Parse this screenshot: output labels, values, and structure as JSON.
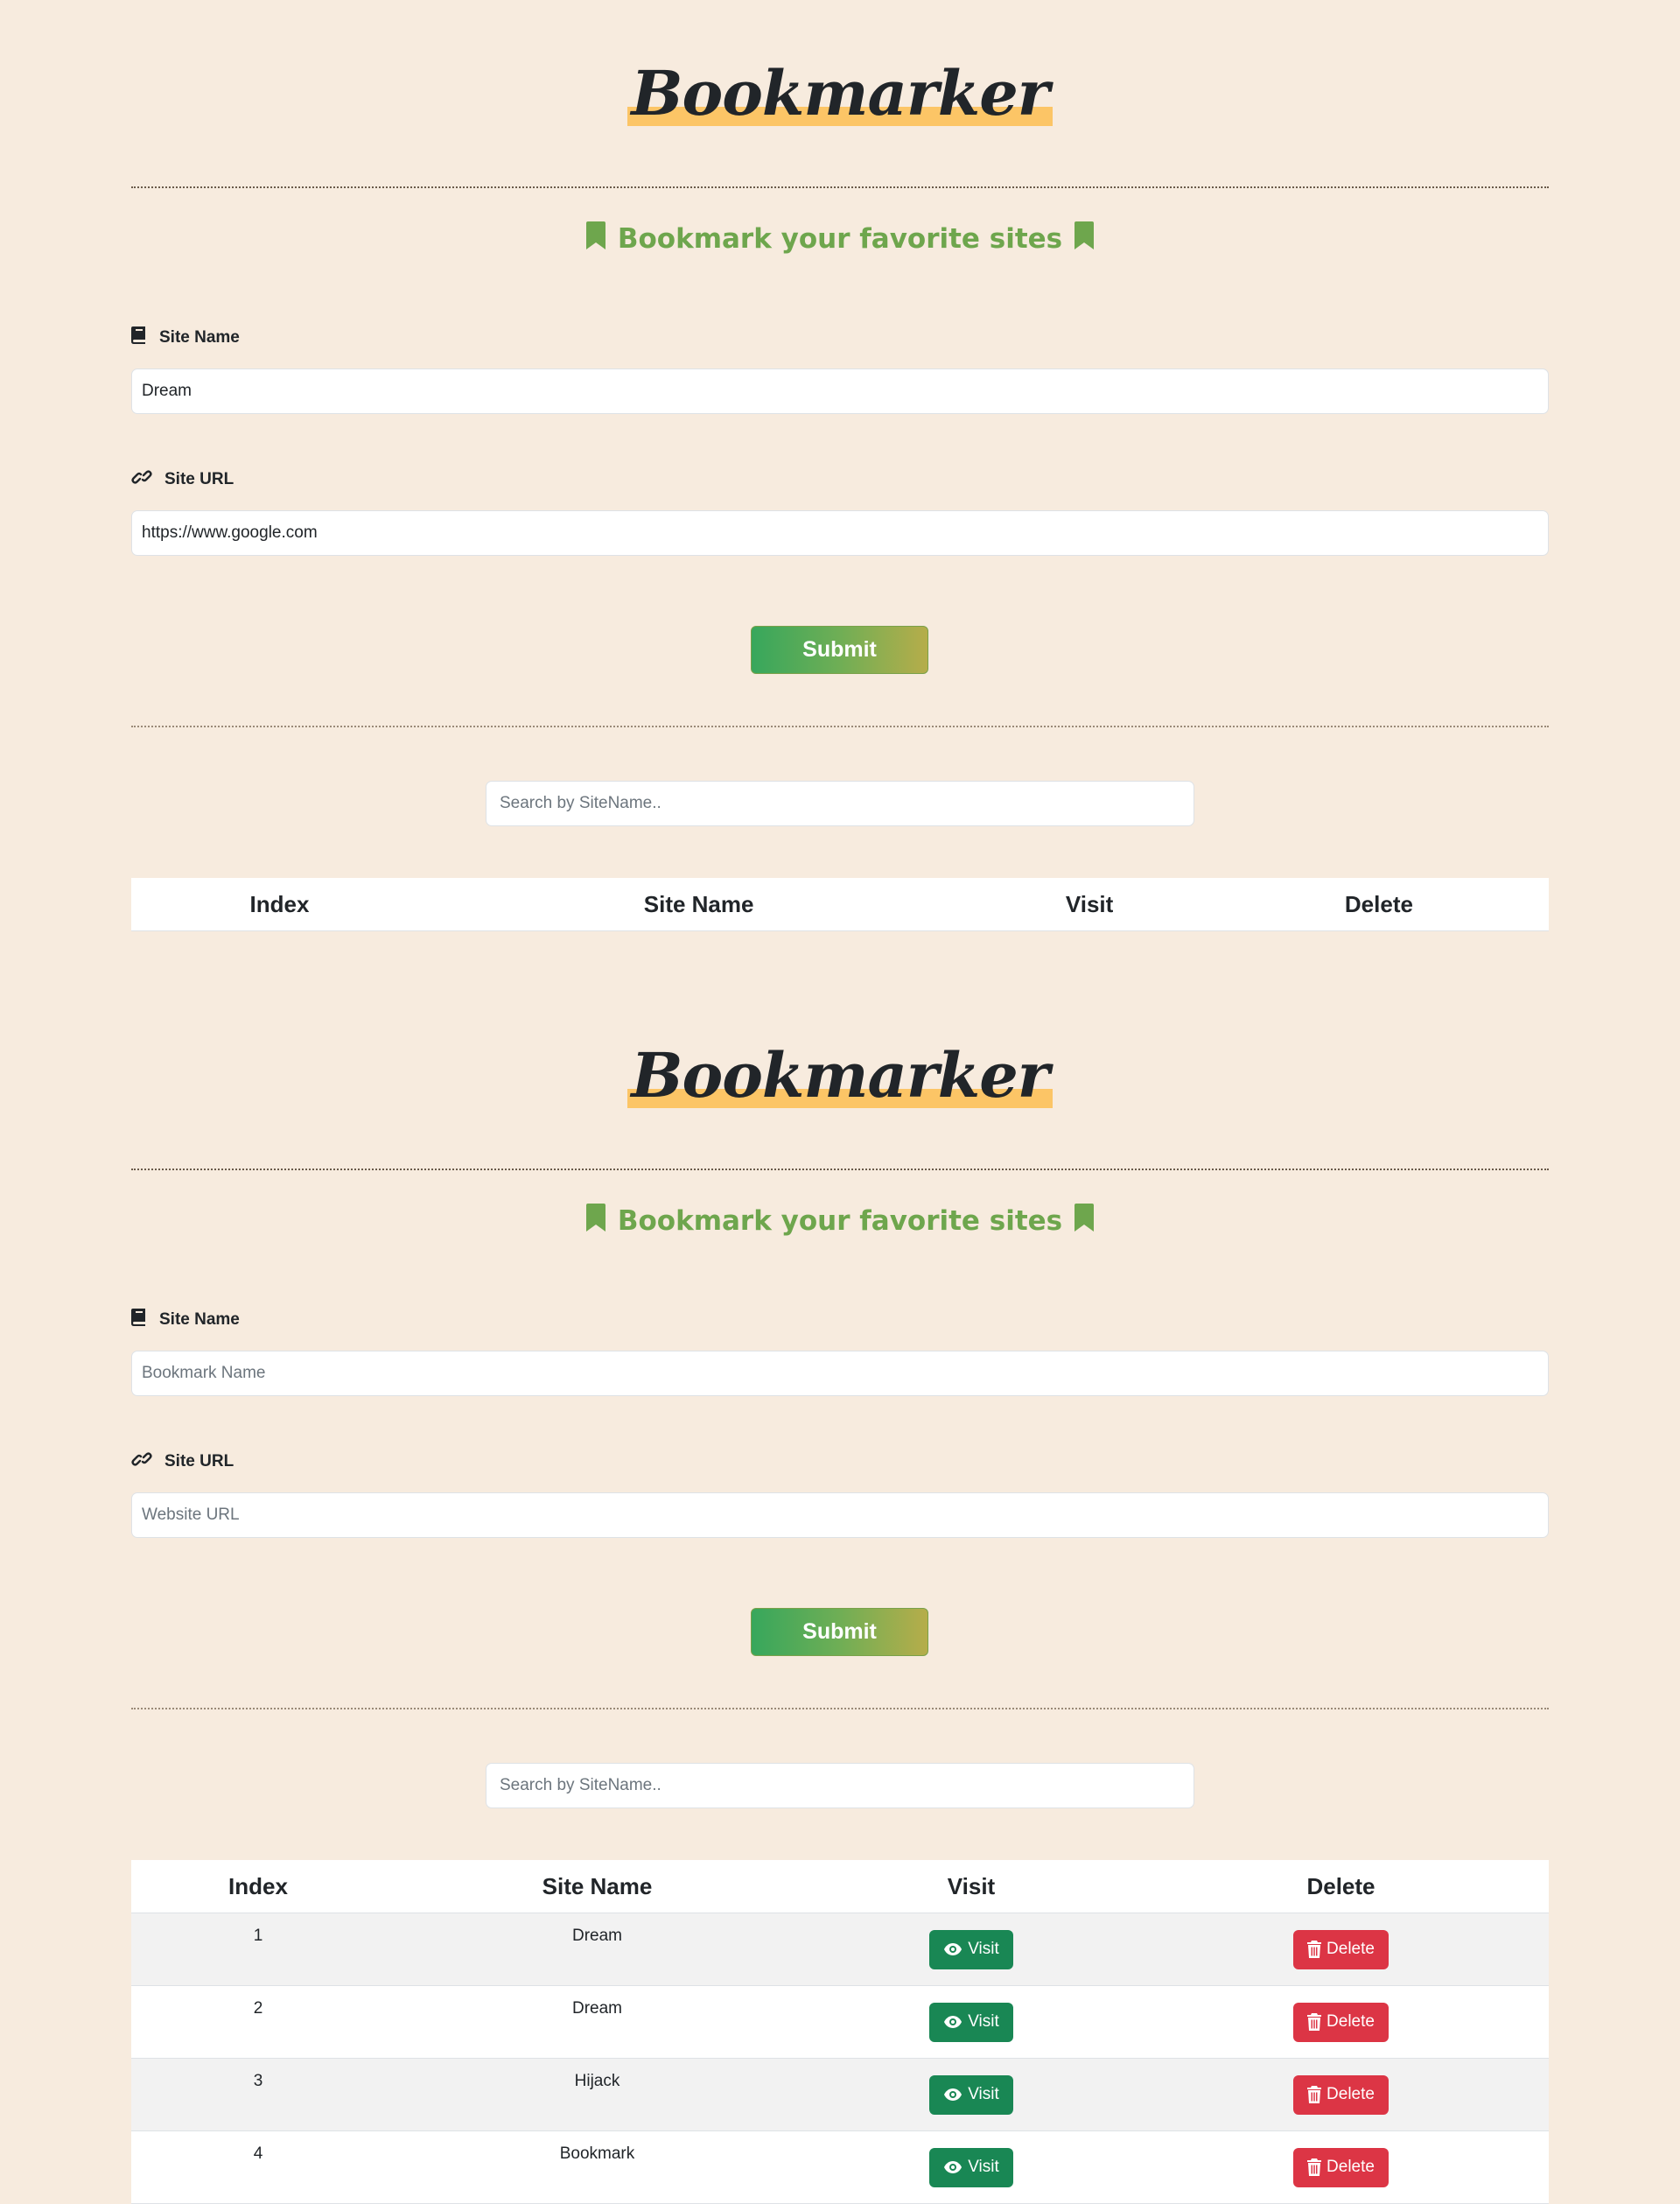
{
  "brand": {
    "logo_text": "Bookmarker",
    "highlight_color": "#fcc566"
  },
  "tagline": {
    "text": "Bookmark your favorite sites",
    "icon_left": "bookmark-icon",
    "icon_right": "bookmark-icon",
    "color": "#6ea64d"
  },
  "colors": {
    "page_bg": "#f7ebde",
    "visit": "#198754",
    "delete": "#dc3545"
  },
  "form1": {
    "site_name_label": "Site Name",
    "site_name_icon": "book-icon",
    "site_name_value": "Dream",
    "site_name_placeholder": "Bookmark Name",
    "site_url_label": "Site URL",
    "site_url_icon": "link-icon",
    "site_url_value": "https://www.google.com",
    "site_url_placeholder": "Website URL",
    "submit_label": "Submit"
  },
  "form2": {
    "site_name_label": "Site Name",
    "site_name_icon": "book-icon",
    "site_name_value": "",
    "site_name_placeholder": "Bookmark Name",
    "site_url_label": "Site URL",
    "site_url_icon": "link-icon",
    "site_url_value": "",
    "site_url_placeholder": "Website URL",
    "submit_label": "Submit"
  },
  "search": {
    "placeholder": "Search by SiteName.."
  },
  "table": {
    "headers": {
      "index": "Index",
      "site_name": "Site Name",
      "visit": "Visit",
      "delete": "Delete"
    },
    "visit_label": "Visit",
    "delete_label": "Delete",
    "rows": [
      {
        "index": "1",
        "site_name": "Dream"
      },
      {
        "index": "2",
        "site_name": "Dream"
      },
      {
        "index": "3",
        "site_name": "Hijack"
      },
      {
        "index": "4",
        "site_name": "Bookmark"
      }
    ]
  }
}
